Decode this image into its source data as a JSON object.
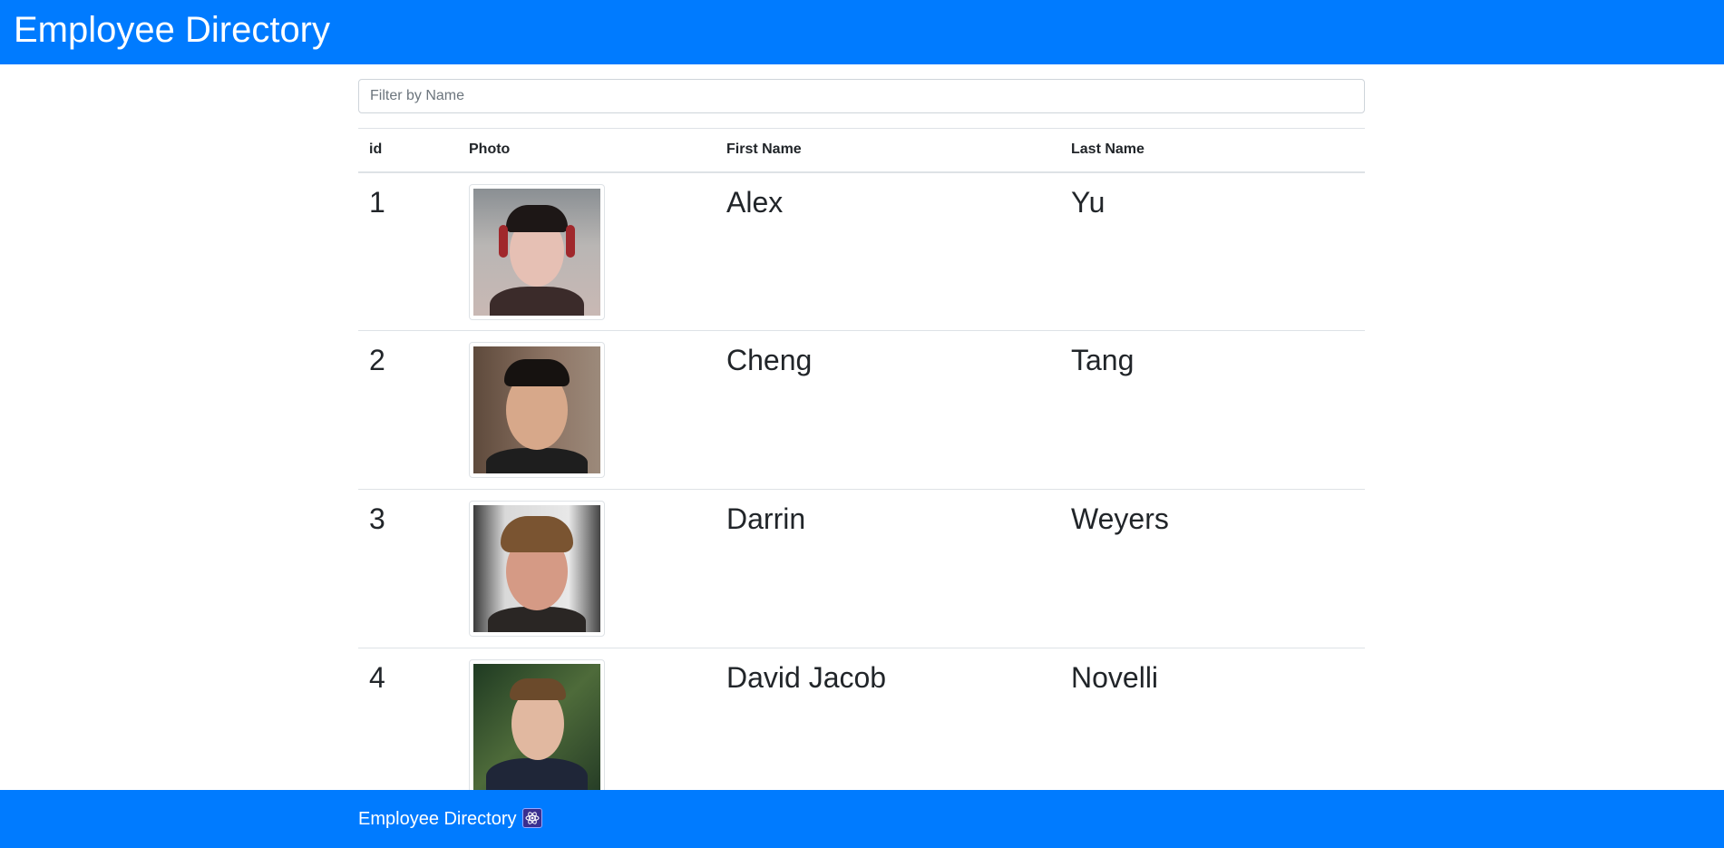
{
  "header": {
    "title": "Employee Directory"
  },
  "filter": {
    "placeholder": "Filter by Name",
    "value": ""
  },
  "table": {
    "columns": [
      "id",
      "Photo",
      "First Name",
      "Last Name"
    ],
    "rows": [
      {
        "id": "1",
        "first_name": "Alex",
        "last_name": "Yu"
      },
      {
        "id": "2",
        "first_name": "Cheng",
        "last_name": "Tang"
      },
      {
        "id": "3",
        "first_name": "Darrin",
        "last_name": "Weyers"
      },
      {
        "id": "4",
        "first_name": "David Jacob",
        "last_name": "Novelli"
      }
    ]
  },
  "footer": {
    "text": "Employee Directory",
    "icon": "react-icon"
  },
  "colors": {
    "brand": "#007bff",
    "text": "#212529",
    "border": "#dee2e6"
  }
}
